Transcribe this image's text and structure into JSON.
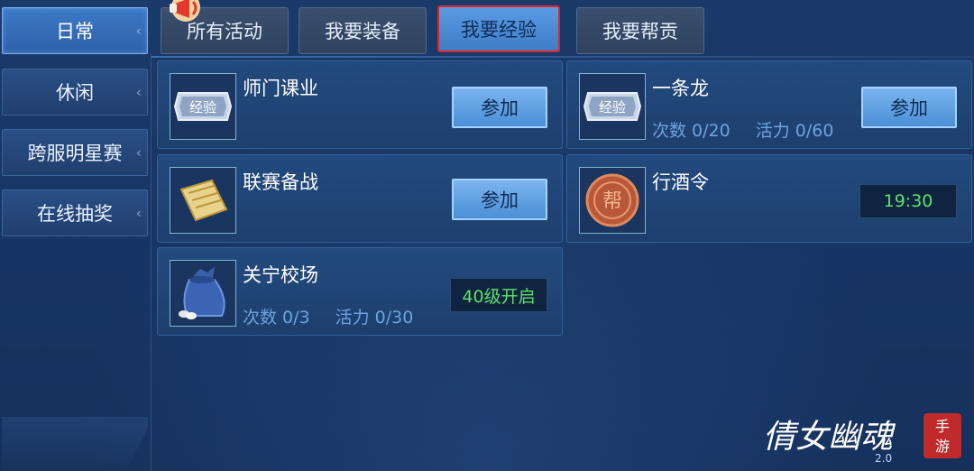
{
  "sidebar": {
    "items": [
      {
        "label": "日常",
        "active": true
      },
      {
        "label": "休闲",
        "active": false
      },
      {
        "label": "跨服明星赛",
        "active": false
      },
      {
        "label": "在线抽奖",
        "active": false
      }
    ]
  },
  "tabs": [
    {
      "label": "所有活动",
      "active": false
    },
    {
      "label": "我要装备",
      "active": false
    },
    {
      "label": "我要经验",
      "active": true
    },
    {
      "label": "我要帮贡",
      "active": false
    }
  ],
  "activities": [
    {
      "title": "师门课业",
      "icon": "exp-token-icon",
      "icon_text": "经验",
      "action": "参加"
    },
    {
      "title": "一条龙",
      "icon": "exp-token-icon",
      "icon_text": "经验",
      "count": "次数 0/20",
      "vitality": "活力 0/60",
      "action": "参加"
    },
    {
      "title": "联赛备战",
      "icon": "scroll-book-icon",
      "action": "参加"
    },
    {
      "title": "行酒令",
      "icon": "guild-coin-icon",
      "icon_text": "帮",
      "status": "19:30"
    },
    {
      "title": "关宁校场",
      "icon": "money-bag-icon",
      "count": "次数 0/3",
      "vitality": "活力 0/30",
      "status": "40级开启"
    }
  ],
  "logo": {
    "main": "倩女幽魂",
    "sub": "2.0",
    "badge": "手游"
  },
  "colors": {
    "accent_active_tab": "#e0242a",
    "status_green": "#5fe06a",
    "stats_blue": "#6fa2dc"
  }
}
